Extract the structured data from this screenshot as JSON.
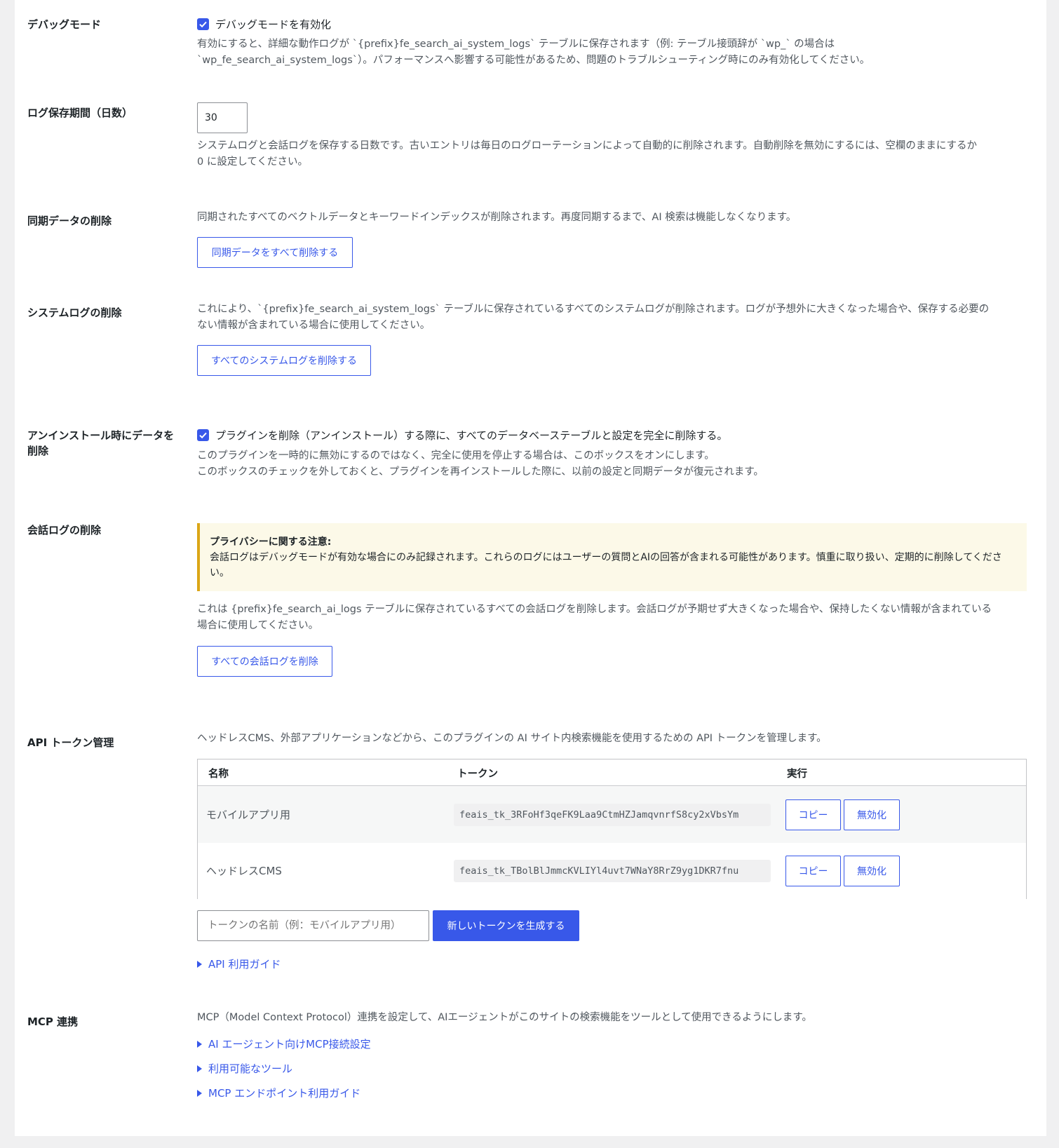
{
  "debug": {
    "label": "デバッグモード",
    "checkbox_label": "デバッグモードを有効化",
    "desc_line1": "有効にすると、詳細な動作ログが `{prefix}fe_search_ai_system_logs` テーブルに保存されます（例: テーブル接頭辞が `wp_` の場合は",
    "desc_line2": "`wp_fe_search_ai_system_logs`）。パフォーマンスへ影響する可能性があるため、問題のトラブルシューティング時にのみ有効化してください。"
  },
  "retention": {
    "label": "ログ保存期間（日数）",
    "value": "30",
    "desc_line1": "システムログと会話ログを保存する日数です。古いエントリは毎日のログローテーションによって自動的に削除されます。自動削除を無効にするには、空欄のままにするか",
    "desc_line2": "0 に設定してください。"
  },
  "sync_delete": {
    "label": "同期データの削除",
    "desc": "同期されたすべてのベクトルデータとキーワードインデックスが削除されます。再度同期するまで、AI 検索は機能しなくなります。",
    "button": "同期データをすべて削除する"
  },
  "syslog_delete": {
    "label": "システムログの削除",
    "desc_line1": "これにより、`{prefix}fe_search_ai_system_logs` テーブルに保存されているすべてのシステムログが削除されます。ログが予想外に大きくなった場合や、保存する必要の",
    "desc_line2": "ない情報が含まれている場合に使用してください。",
    "button": "すべてのシステムログを削除する"
  },
  "uninstall": {
    "label_line1": "アンインストール時にデータを",
    "label_line2": "削除",
    "checkbox_label": "プラグインを削除（アンインストール）する際に、すべてのデータベーステーブルと設定を完全に削除する。",
    "desc_line1": "このプラグインを一時的に無効にするのではなく、完全に使用を停止する場合は、このボックスをオンにします。",
    "desc_line2": "このボックスのチェックを外しておくと、プラグインを再インストールした際に、以前の設定と同期データが復元されます。"
  },
  "convlog_delete": {
    "label": "会話ログの削除",
    "notice_title": "プライバシーに関する注意:",
    "notice_line1": "会話ログはデバッグモードが有効な場合にのみ記録されます。これらのログにはユーザーの質問とAIの回答が含まれる可能性があります。慎重に取り扱い、定期的に削除してくださ",
    "notice_line2": "い。",
    "desc_line1": "これは {prefix}fe_search_ai_logs テーブルに保存されているすべての会話ログを削除します。会話ログが予期せず大きくなった場合や、保持したくない情報が含まれている",
    "desc_line2": "場合に使用してください。",
    "button": "すべての会話ログを削除"
  },
  "api": {
    "label": "API トークン管理",
    "desc": "ヘッドレスCMS、外部アプリケーションなどから、このプラグインの AI サイト内検索機能を使用するための API トークンを管理します。",
    "columns": [
      "名称",
      "トークン",
      "実行"
    ],
    "rows": [
      {
        "name": "モバイルアプリ用",
        "token": "feais_tk_3RFoHf3qeFK9Laa9CtmHZJamqvnrfS8cy2xVbsYm",
        "copy": "コピー",
        "disable": "無効化"
      },
      {
        "name": "ヘッドレスCMS",
        "token": "feais_tk_TBolBlJmmcKVLIYl4uvt7WNaY8RrZ9yg1DKR7fnu",
        "copy": "コピー",
        "disable": "無効化"
      }
    ],
    "new_token_placeholder": "トークンの名前（例：モバイルアプリ用）",
    "generate_button": "新しいトークンを生成する",
    "guide": "API 利用ガイド"
  },
  "mcp": {
    "label": "MCP 連携",
    "desc": "MCP（Model Context Protocol）連携を設定して、AIエージェントがこのサイトの検索機能をツールとして使用できるようにします。",
    "links": [
      "AI エージェント向けMCP接続設定",
      "利用可能なツール",
      "MCP エンドポイント利用ガイド"
    ]
  },
  "colors": {
    "accent": "#3858e9",
    "notice_bg": "#fcf9e8",
    "notice_border": "#dba617",
    "row_alt": "#f6f7f7"
  }
}
